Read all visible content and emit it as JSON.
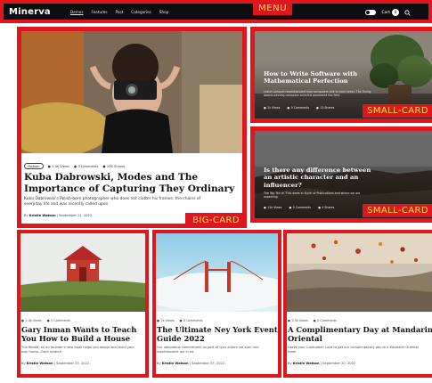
{
  "menu": {
    "logo": "Minerva",
    "nav": [
      "Demos",
      "Features",
      "Post",
      "Categories",
      "Shop"
    ],
    "label": "MENU",
    "cart_label": "Cart",
    "cart_count": "0"
  },
  "big_card": {
    "category": "Fashion",
    "views": "2.4K Views",
    "comments": "0 Comments",
    "shares": "200 Shares",
    "title": "Kuba Dabrowski, Modes and The Importance of Capturing They Ordinary",
    "excerpt": "Kuba Dabrowski's Polish-born photographer who does not clutter his frames: the chains of everyday life and was recently called upon",
    "author_prefix": "By",
    "author": "Kristin Watson",
    "date": "September 21, 2022",
    "label": "BIG-CARD"
  },
  "small_cards": [
    {
      "title": "How to Write Software with Mathematical Perfection",
      "excerpt": "Leslie Lamport revolutionized how computers talk to each other. The Turing Award-winning computer scientist pioneered the field",
      "views": "2k Views",
      "comments": "0 Comments",
      "extra": "13 Shares",
      "label": "SMALL-CARD"
    },
    {
      "title": "Is there any difference between an artistic character and an influencer?",
      "excerpt": "The Top Ten of 'This week in Style' of Publications and where we are expecting",
      "views": "12k Views",
      "comments": "0 Comments",
      "extra": "4 Shares",
      "label": "SMALL-CARD"
    }
  ],
  "bottom_cards": [
    {
      "views": "2.3k Views",
      "comments": "0 Comments",
      "title": "Gary Inman Wants to Teach You How to Build a House",
      "excerpt": "The Reddit, on an founder's new book helps you design and build your own home—from scratch",
      "author_prefix": "By",
      "author": "Kristin Watson",
      "date": "September 23, 2022"
    },
    {
      "views": "2k Views",
      "comments": "0 Comments",
      "title": "The Ultimate Ney York Event Guide 2022",
      "excerpt": "Our ubiquitous commitment as part of Quis autem vel eum iure reprehenderit qui in ea.",
      "author_prefix": "By",
      "author": "Kristin Watson",
      "date": "September 07, 2022"
    },
    {
      "views": "2.5k Views",
      "comments": "0 Comments",
      "title": "A Complimentary Day at Mandarin Oriental",
      "excerpt": "Leave your Coronation Card to get our complimentary day at a Mandarin Oriental hotel",
      "author_prefix": "By",
      "author": "Kristin Watson",
      "date": "September 20, 2022"
    }
  ],
  "colors": {
    "annotation_red": "#e0161f",
    "annotation_text": "#ffe34d",
    "menu_bg": "#0e0e10"
  },
  "icons": [
    "dark-mode-toggle-icon",
    "search-icon",
    "eye-icon",
    "comment-icon",
    "share-icon"
  ]
}
